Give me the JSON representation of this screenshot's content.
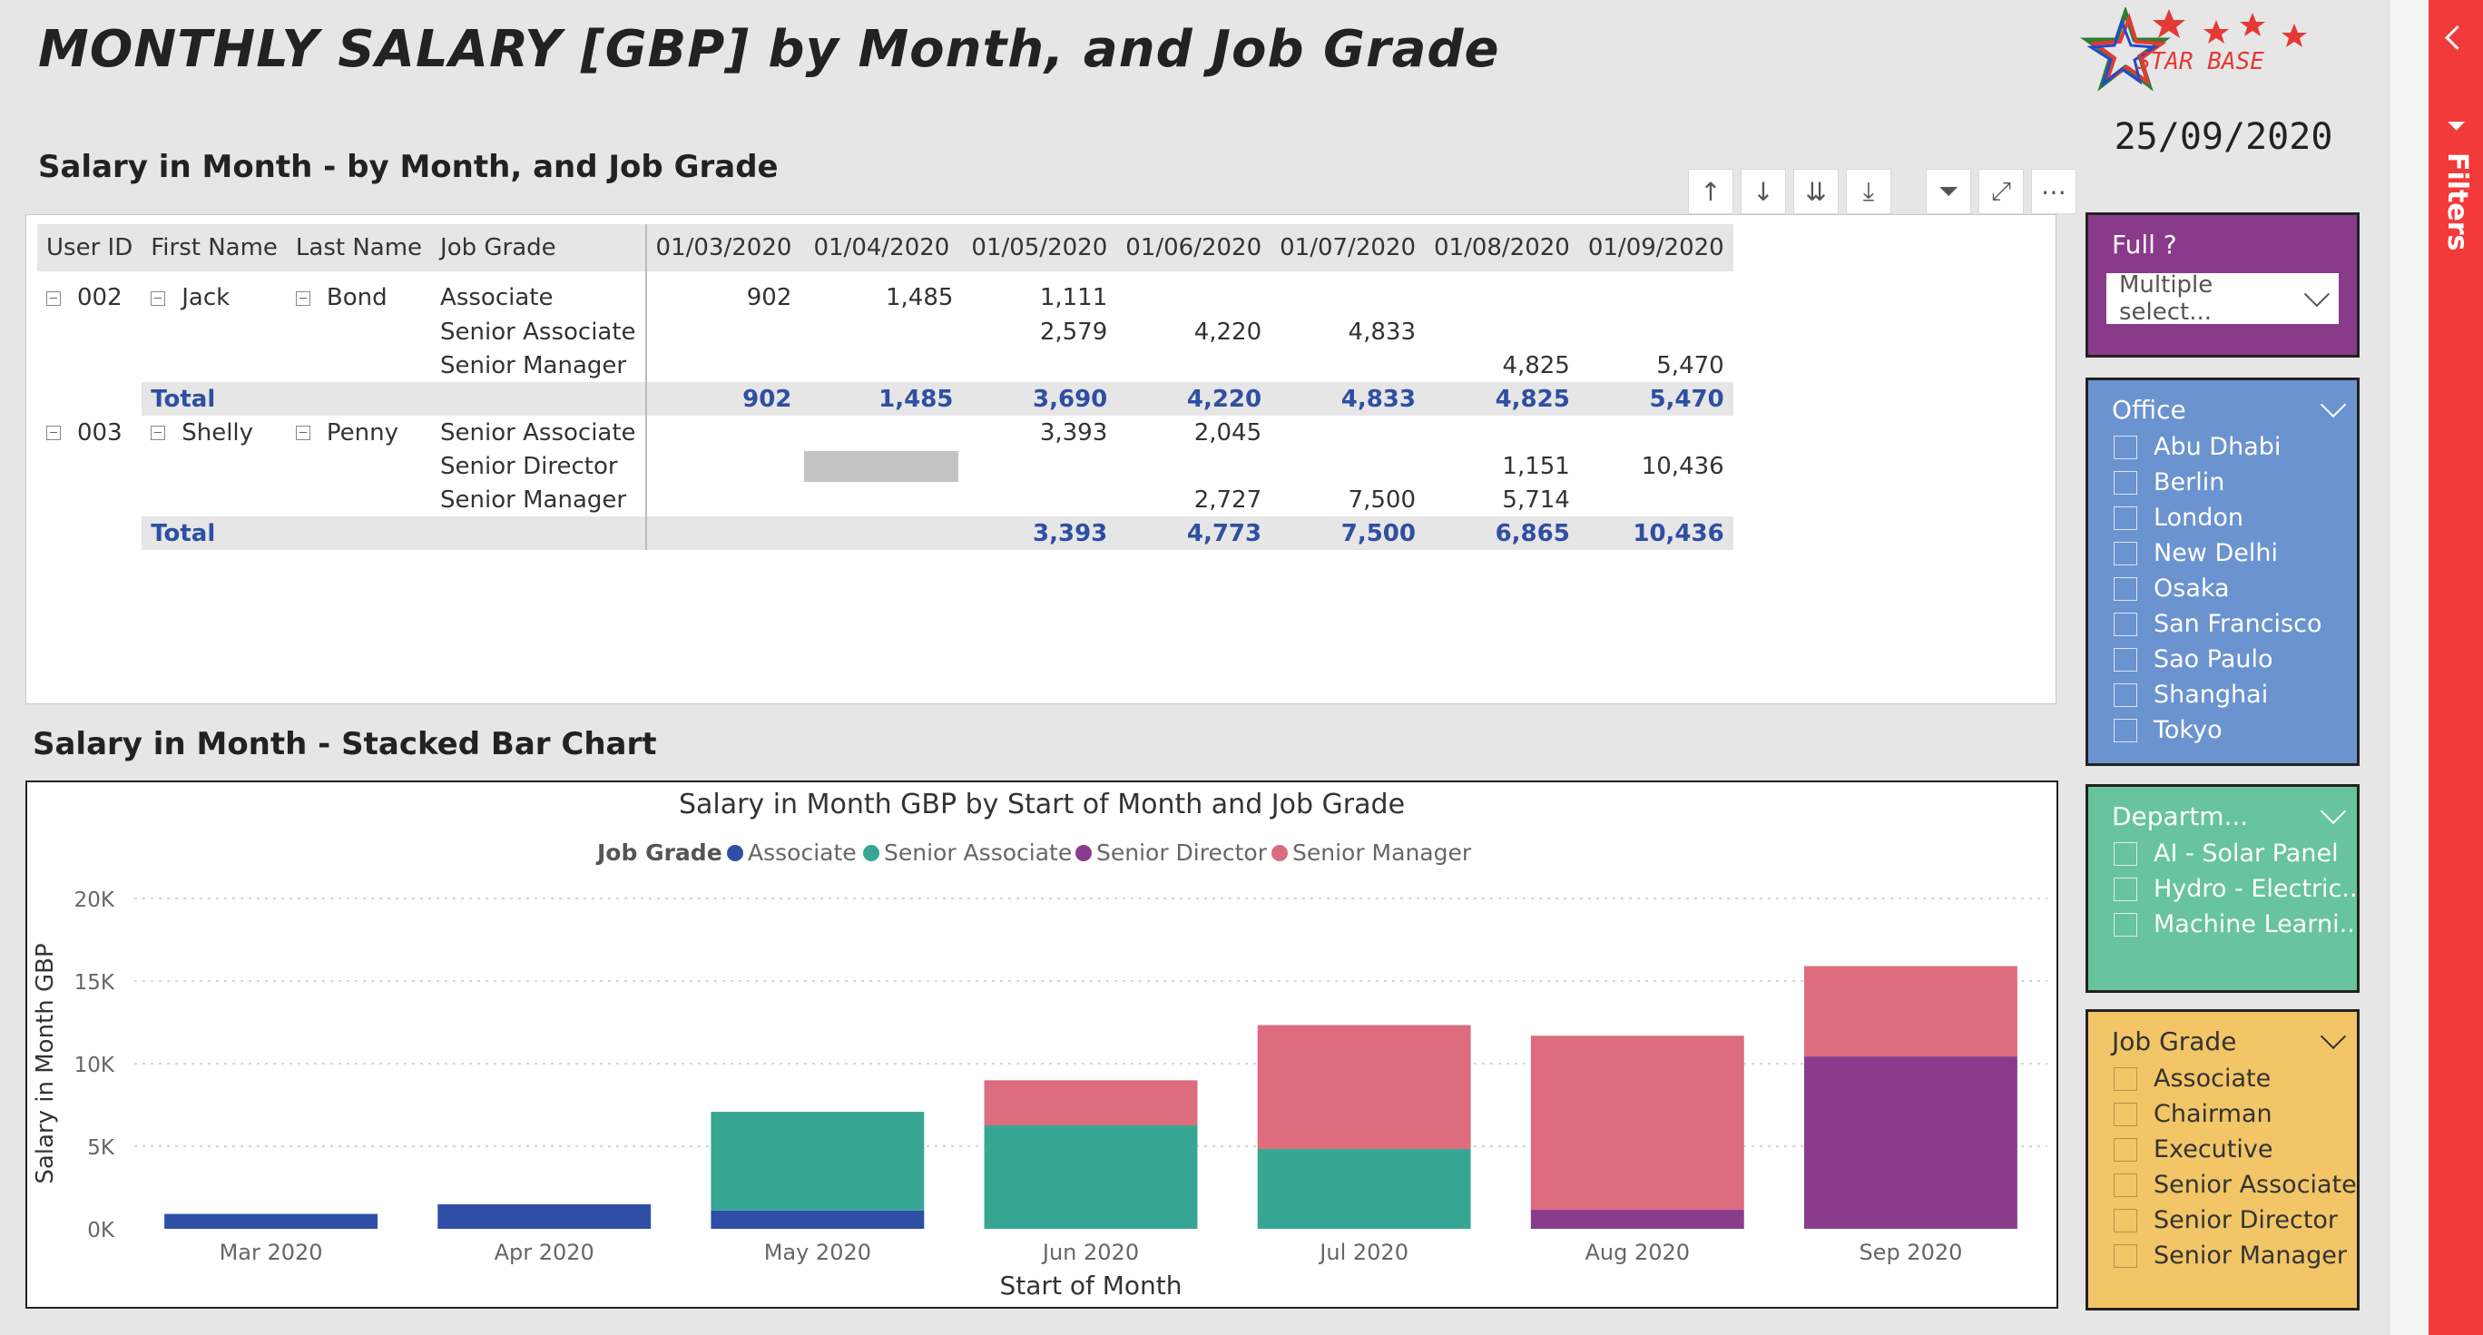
{
  "title": "MONTHLY SALARY [GBP] by Month, and Job Grade",
  "logo_text": "STAR BASE",
  "report_date": "25/09/2020",
  "matrix": {
    "section_title": "Salary in Month - by Month, and Job Grade",
    "headers": [
      "User ID",
      "First Name",
      "Last Name",
      "Job Grade",
      "01/03/2020",
      "01/04/2020",
      "01/05/2020",
      "01/06/2020",
      "01/07/2020",
      "01/08/2020",
      "01/09/2020"
    ],
    "rows": [
      [
        "002",
        "Jack",
        "Bond",
        "Associate",
        "902",
        "1,485",
        "1,111",
        "",
        "",
        "",
        ""
      ],
      [
        "",
        "",
        "",
        "Senior Associate",
        "",
        "",
        "2,579",
        "4,220",
        "4,833",
        "",
        ""
      ],
      [
        "",
        "",
        "",
        "Senior Manager",
        "",
        "",
        "",
        "",
        "",
        "4,825",
        "5,470"
      ],
      [
        "",
        "Total",
        "",
        "",
        "902",
        "1,485",
        "3,690",
        "4,220",
        "4,833",
        "4,825",
        "5,470"
      ],
      [
        "003",
        "Shelly",
        "Penny",
        "Senior Associate",
        "",
        "",
        "3,393",
        "2,045",
        "",
        "",
        ""
      ],
      [
        "",
        "",
        "",
        "Senior Director",
        "",
        "",
        "",
        "",
        "",
        "1,151",
        "10,436"
      ],
      [
        "",
        "",
        "",
        "Senior Manager",
        "",
        "",
        "",
        "2,727",
        "7,500",
        "5,714",
        ""
      ],
      [
        "",
        "Total",
        "",
        "",
        "",
        "",
        "3,393",
        "4,773",
        "7,500",
        "6,865",
        "10,436"
      ]
    ]
  },
  "chart_section_title": "Salary in Month - Stacked Bar Chart",
  "chart_data": {
    "type": "bar",
    "stacked": true,
    "title": "Salary in Month GBP by Start of Month and Job Grade",
    "legend_title": "Job Grade",
    "legend_position": "top",
    "xlabel": "Start of Month",
    "ylabel": "Salary in Month GBP",
    "ylim": [
      0,
      20000
    ],
    "yticks": [
      "0K",
      "5K",
      "10K",
      "15K",
      "20K"
    ],
    "grid": true,
    "categories": [
      "Mar 2020",
      "Apr 2020",
      "May 2020",
      "Jun 2020",
      "Jul 2020",
      "Aug 2020",
      "Sep 2020"
    ],
    "series": [
      {
        "name": "Associate",
        "color": "#2f4fa6",
        "values": [
          902,
          1485,
          1111,
          0,
          0,
          0,
          0
        ]
      },
      {
        "name": "Senior Associate",
        "color": "#37a794",
        "values": [
          0,
          0,
          5972,
          6265,
          4833,
          0,
          0
        ]
      },
      {
        "name": "Senior Director",
        "color": "#8a3c8c",
        "values": [
          0,
          0,
          0,
          0,
          0,
          1151,
          10436
        ]
      },
      {
        "name": "Senior Manager",
        "color": "#dd6c7f",
        "values": [
          0,
          0,
          0,
          2727,
          7500,
          10539,
          5470
        ]
      }
    ]
  },
  "slicers": {
    "full": {
      "title": "Full ?",
      "value": "Multiple select...",
      "color": "#8a3a8a"
    },
    "office": {
      "title": "Office",
      "color": "#6b93cf",
      "items": [
        "Abu Dhabi",
        "Berlin",
        "London",
        "New Delhi",
        "Osaka",
        "San Francisco",
        "Sao Paulo",
        "Shanghai",
        "Tokyo"
      ]
    },
    "department": {
      "title": "Departm...",
      "color": "#67c49c",
      "items": [
        "AI - Solar Panel",
        "Hydro - Electric...",
        "Machine Learni..."
      ]
    },
    "job_grade": {
      "title": "Job Grade",
      "color": "#f2c566",
      "items": [
        "Associate",
        "Chairman",
        "Executive",
        "Senior Associate",
        "Senior Director",
        "Senior Manager"
      ]
    }
  },
  "filters_pane": {
    "label": "Filters"
  }
}
